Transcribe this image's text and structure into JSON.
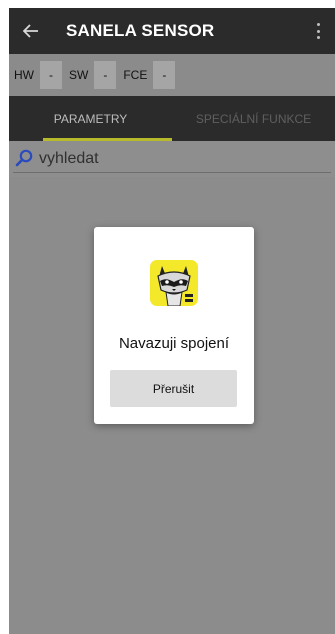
{
  "appbar": {
    "back_icon": "arrow-left-icon",
    "title": "SANELA SENSOR",
    "menu_icon": "more-vertical-icon"
  },
  "info": {
    "hw_label": "HW",
    "hw_value": "-",
    "sw_label": "SW",
    "sw_value": "-",
    "fce_label": "FCE",
    "fce_value": "-"
  },
  "tabs": [
    {
      "label": "PARAMETRY",
      "active": true
    },
    {
      "label": "SPECIÁLNÍ FUNKCE",
      "active": false
    }
  ],
  "search": {
    "placeholder": "vyhledat",
    "icon": "search-icon"
  },
  "dialog": {
    "logo": "raccoon-logo",
    "message": "Navazuji spojení",
    "button_label": "Přerušit"
  },
  "colors": {
    "appbar": "#2b2b2b",
    "tab_indicator": "#b7bb2b",
    "logo_bg": "#f3e82a"
  }
}
